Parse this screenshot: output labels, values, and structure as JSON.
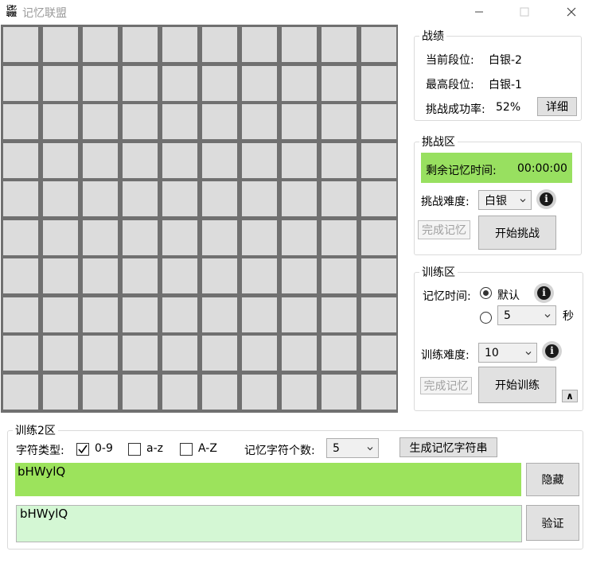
{
  "window": {
    "title": "记忆联盟",
    "icon_text": "记忆联盟"
  },
  "stats": {
    "legend": "战绩",
    "current_rank_label": "当前段位:",
    "current_rank_value": "白银-2",
    "highest_rank_label": "最高段位:",
    "highest_rank_value": "白银-1",
    "success_rate_label": "挑战成功率:",
    "success_rate_value": "52%",
    "details_button": "详细"
  },
  "challenge": {
    "legend": "挑战区",
    "remaining_label": "剩余记忆时间:",
    "remaining_value": "00:00:00",
    "difficulty_label": "挑战难度:",
    "difficulty_value": "白银",
    "info_glyph": "i",
    "done_button": "完成记忆",
    "start_button": "开始挑战"
  },
  "training": {
    "legend": "训练区",
    "time_label": "记忆时间:",
    "default_option": "默认",
    "custom_value": "5",
    "seconds_unit": "秒",
    "difficulty_label": "训练难度:",
    "difficulty_value": "10",
    "info_glyph": "i",
    "done_button": "完成记忆",
    "start_button": "开始训练",
    "collapse_glyph": "∧"
  },
  "training2": {
    "legend": "训练2区",
    "char_type_label": "字符类型:",
    "options": [
      "0-9",
      "a-z",
      "A-Z"
    ],
    "checked": [
      true,
      false,
      false
    ],
    "count_label": "记忆字符个数:",
    "count_value": "5",
    "generate_button": "生成记忆字符串",
    "display_text": "bHWylQ",
    "input_text": "bHWylQ",
    "hide_button": "隐藏",
    "verify_button": "验证"
  },
  "colors": {
    "timer_bg": "#98e060",
    "display_bg": "#9ce35c",
    "input_bg": "#d4f7d4",
    "grid_line": "#707070",
    "cell": "#dcdcdc"
  }
}
